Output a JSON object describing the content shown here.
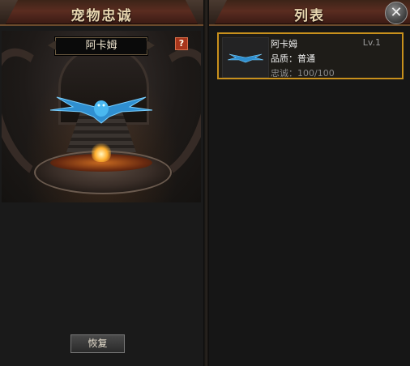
{
  "left_panel": {
    "title": "宠物忠诚",
    "pet_name": "阿卡姆",
    "help_label": "?",
    "restore_label": "恢复"
  },
  "right_panel": {
    "title": "列表",
    "close_label": "✕",
    "items": [
      {
        "name": "阿卡姆",
        "level": "Lv.1",
        "quality": "品质：普通",
        "loyalty": "忠诚：100/100"
      }
    ]
  },
  "colors": {
    "title_text": "#e8d6b0",
    "selected_border": "#c8901c",
    "pet_blue": "#3aa6e6"
  },
  "icons": [
    "close-icon",
    "help-icon",
    "pet-sprite-icon"
  ]
}
